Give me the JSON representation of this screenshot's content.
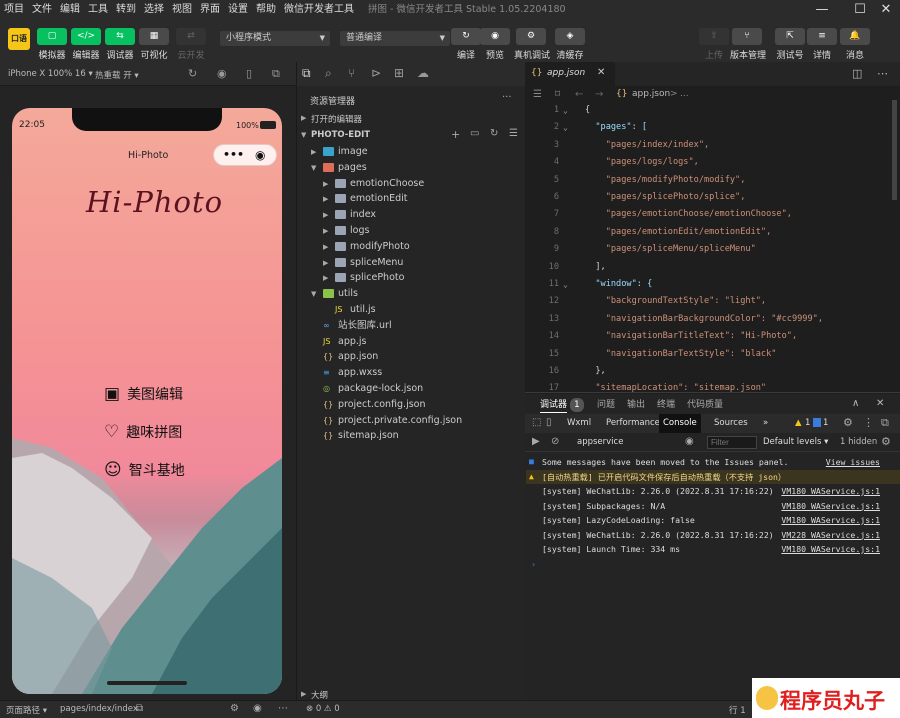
{
  "menubar": {
    "items": [
      "项目",
      "文件",
      "编辑",
      "工具",
      "转到",
      "选择",
      "视图",
      "界面",
      "设置",
      "帮助",
      "微信开发者工具"
    ],
    "title": "拼图 - 微信开发者工具 Stable 1.05.2204180"
  },
  "window_controls": {
    "minimize": "—",
    "maximize": "☐",
    "close": "✕"
  },
  "toolbar": {
    "logo": "口语",
    "left_buttons": [
      {
        "icon": "▢",
        "label": "模拟器"
      },
      {
        "icon": "</>",
        "label": "编辑器"
      },
      {
        "icon": "⇆",
        "label": "调试器"
      },
      {
        "icon": "▦",
        "label": "可视化"
      },
      {
        "icon": "⇄",
        "label": "云开发"
      }
    ],
    "mode_select": "小程序模式",
    "compile_select": "普通编译",
    "mid_buttons": [
      {
        "icon": "↻",
        "label": "编译"
      },
      {
        "icon": "◉",
        "label": "预览"
      },
      {
        "icon": "⚙",
        "label": "真机调试"
      },
      {
        "icon": "◈",
        "label": "清缓存"
      }
    ],
    "right_buttons": [
      {
        "icon": "⇧",
        "label": "上传"
      },
      {
        "icon": "⑂",
        "label": "版本管理"
      },
      {
        "icon": "⇱",
        "label": "测试号"
      },
      {
        "icon": "≡",
        "label": "详情"
      },
      {
        "icon": "🔔",
        "label": "消息"
      }
    ]
  },
  "simulator": {
    "device": "iPhone X 100% 16 ▾",
    "hotreload": "热重载 开 ▾",
    "time": "22:05",
    "battery": "100%",
    "nav_title": "Hi-Photo",
    "capsule_dots": "•••",
    "capsule_target": "◉",
    "brand": "Hi-Photo",
    "menu": [
      {
        "icon": "▣",
        "label": "美图编辑"
      },
      {
        "icon": "♡",
        "label": "趣味拼图"
      },
      {
        "icon": "☺",
        "label": "智斗基地"
      }
    ],
    "page_path_label": "页面路径 ▾",
    "page_path": "pages/index/index"
  },
  "explorer": {
    "title": "资源管理器",
    "more": "···",
    "open_editors": "打开的编辑器",
    "project": "PHOTO-EDIT",
    "outline": "大纲",
    "tree": [
      {
        "name": "image",
        "depth": 1,
        "type": "folder-img",
        "open": false
      },
      {
        "name": "pages",
        "depth": 1,
        "type": "folder-pages",
        "open": true
      },
      {
        "name": "emotionChoose",
        "depth": 2,
        "type": "folder",
        "open": false
      },
      {
        "name": "emotionEdit",
        "depth": 2,
        "type": "folder",
        "open": false
      },
      {
        "name": "index",
        "depth": 2,
        "type": "folder",
        "open": false
      },
      {
        "name": "logs",
        "depth": 2,
        "type": "folder",
        "open": false
      },
      {
        "name": "modifyPhoto",
        "depth": 2,
        "type": "folder",
        "open": false
      },
      {
        "name": "spliceMenu",
        "depth": 2,
        "type": "folder",
        "open": false
      },
      {
        "name": "splicePhoto",
        "depth": 2,
        "type": "folder",
        "open": false
      },
      {
        "name": "utils",
        "depth": 1,
        "type": "folder-utils",
        "open": true
      },
      {
        "name": "util.js",
        "depth": 2,
        "type": "js"
      },
      {
        "name": "站长图库.url",
        "depth": 1,
        "type": "url"
      },
      {
        "name": "app.js",
        "depth": 1,
        "type": "js"
      },
      {
        "name": "app.json",
        "depth": 1,
        "type": "json"
      },
      {
        "name": "app.wxss",
        "depth": 1,
        "type": "wxss"
      },
      {
        "name": "package-lock.json",
        "depth": 1,
        "type": "lock"
      },
      {
        "name": "project.config.json",
        "depth": 1,
        "type": "json"
      },
      {
        "name": "project.private.config.json",
        "depth": 1,
        "type": "json"
      },
      {
        "name": "sitemap.json",
        "depth": 1,
        "type": "json"
      }
    ]
  },
  "editor": {
    "tab": "app.json",
    "breadcrumb": "app.json",
    "breadcrumb_sep": ">",
    "breadcrumb_more": "...",
    "lines": [
      {
        "n": "1",
        "t": "{"
      },
      {
        "n": "2",
        "t": "  \"pages\": ["
      },
      {
        "n": "3",
        "t": "    \"pages/index/index\","
      },
      {
        "n": "4",
        "t": "    \"pages/logs/logs\","
      },
      {
        "n": "5",
        "t": "    \"pages/modifyPhoto/modify\","
      },
      {
        "n": "6",
        "t": "    \"pages/splicePhoto/splice\","
      },
      {
        "n": "7",
        "t": "    \"pages/emotionChoose/emotionChoose\","
      },
      {
        "n": "8",
        "t": "    \"pages/emotionEdit/emotionEdit\","
      },
      {
        "n": "9",
        "t": "    \"pages/spliceMenu/spliceMenu\""
      },
      {
        "n": "10",
        "t": "  ],"
      },
      {
        "n": "11",
        "t": "  \"window\": {"
      },
      {
        "n": "12",
        "t": "    \"backgroundTextStyle\": \"light\","
      },
      {
        "n": "13",
        "t": "    \"navigationBarBackgroundColor\": \"#cc9999\","
      },
      {
        "n": "14",
        "t": "    \"navigationBarTitleText\": \"Hi-Photo\","
      },
      {
        "n": "15",
        "t": "    \"navigationBarTextStyle\": \"black\""
      },
      {
        "n": "16",
        "t": "  },"
      },
      {
        "n": "17",
        "t": "  \"sitemapLocation\": \"sitemap.json\""
      }
    ]
  },
  "devtools": {
    "tabs": [
      "调试器",
      "1",
      "问题",
      "输出",
      "终端",
      "代码质量"
    ],
    "subtabs": [
      "Wxml",
      "Performance",
      "Console",
      "Sources",
      "»"
    ],
    "warn_count": "1",
    "err_count": "1",
    "context": "appservice",
    "filter_placeholder": "Filter",
    "levels": "Default levels ▾",
    "hidden": "1 hidden",
    "messages": [
      {
        "kind": "info",
        "text": "Some messages have been moved to the Issues panel.",
        "link": "View issues"
      },
      {
        "kind": "warn",
        "text": "[自动热重载] 已开启代码文件保存后自动热重载（不支持 json）",
        "link": ""
      },
      {
        "kind": "log",
        "text": "[system] WeChatLib: 2.26.0 (2022.8.31 17:16:22)",
        "link": "VM180 WAService.js:1"
      },
      {
        "kind": "log",
        "text": "[system] Subpackages: N/A",
        "link": "VM180 WAService.js:1"
      },
      {
        "kind": "log",
        "text": "[system] LazyCodeLoading: false",
        "link": "VM180 WAService.js:1"
      },
      {
        "kind": "log",
        "text": "[system] WeChatLib: 2.26.0 (2022.8.31 17:16:22)",
        "link": "VM228 WAService.js:1"
      },
      {
        "kind": "log",
        "text": "[system] Launch Time: 334 ms",
        "link": "VM180 WAService.js:1"
      }
    ],
    "prompt": "›"
  },
  "statusbar": {
    "errors": "⊗ 0 ⚠ 0",
    "position": "行 1"
  },
  "watermark": {
    "text": "程序员丸子"
  },
  "colors": {
    "accent": "#07c160",
    "bg": "#1e1e1e",
    "panel": "#252526"
  }
}
